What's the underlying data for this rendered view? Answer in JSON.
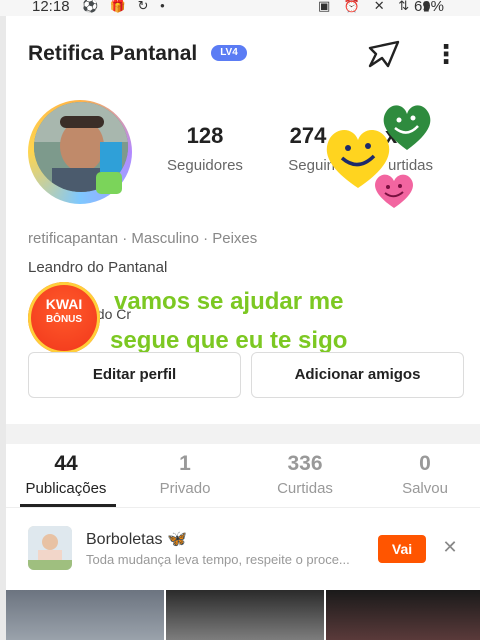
{
  "status_bar": {
    "time": "12:18",
    "battery": "69%"
  },
  "profile": {
    "title": "Retifica Pantanal",
    "level_badge": "LV4",
    "stats": [
      {
        "value": "128",
        "label": "Seguidores"
      },
      {
        "value": "274",
        "label": "Seguindo"
      },
      {
        "value": "x",
        "label": "urtidas"
      }
    ],
    "tags": "retificapantan · Masculino · Peixes",
    "real_name": "Leandro do Pantanal",
    "bio_partial": "al do Cr",
    "overlay_line1": "vamos se ajudar me",
    "overlay_line2": "segue que eu te sigo"
  },
  "kwai_badge": {
    "line1": "KWAI",
    "line2": "BÔNUS"
  },
  "actions": {
    "edit_profile": "Editar perfil",
    "add_friends": "Adicionar amigos"
  },
  "tabs": [
    {
      "count": "44",
      "label": "Publicações",
      "active": true
    },
    {
      "count": "1",
      "label": "Privado",
      "active": false
    },
    {
      "count": "336",
      "label": "Curtidas",
      "active": false
    },
    {
      "count": "0",
      "label": "Salvou",
      "active": false
    }
  ],
  "story": {
    "title": "Borboletas 🦋",
    "subtitle": "Toda mudança leva tempo, respeite o proce...",
    "button": "Vai"
  },
  "colors": {
    "accent_orange": "#ff5500",
    "overlay_green": "#7cc822",
    "badge_blue": "#5b7cf4"
  },
  "icons": [
    "share-icon",
    "more-icon",
    "close-icon"
  ]
}
